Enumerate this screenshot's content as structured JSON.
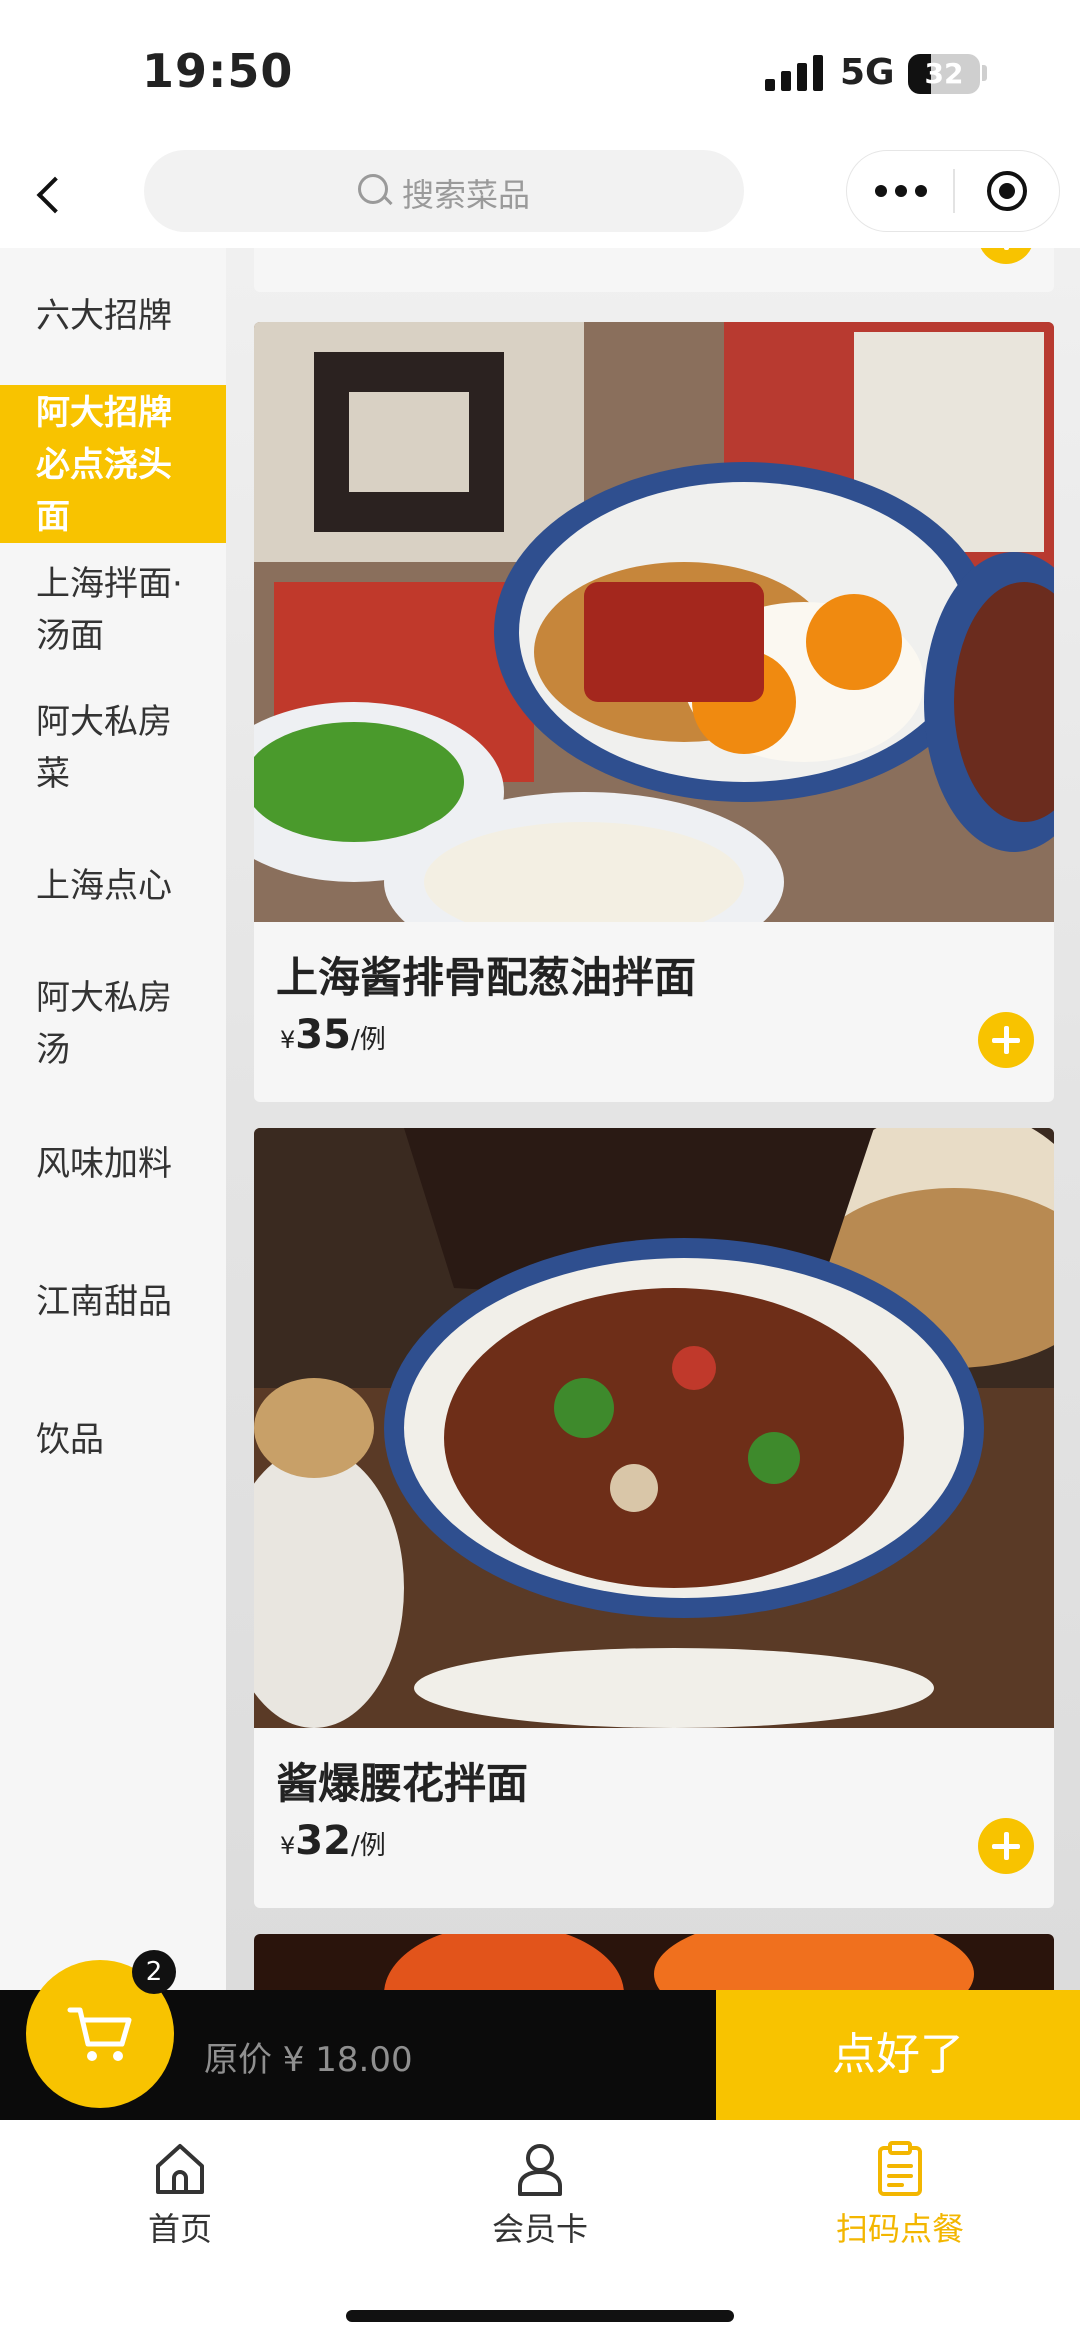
{
  "status": {
    "time": "19:50",
    "network": "5G",
    "battery": "32",
    "battery_level": 0.32
  },
  "header": {
    "search_placeholder": "搜索菜品"
  },
  "sidebar": {
    "items": [
      {
        "label": "六大招牌",
        "active": false
      },
      {
        "label": "阿大招牌必点浇头面",
        "active": true
      },
      {
        "label": "上海拌面·汤面",
        "active": false
      },
      {
        "label": "阿大私房菜",
        "active": false
      },
      {
        "label": "上海点心",
        "active": false
      },
      {
        "label": "阿大私房汤",
        "active": false
      },
      {
        "label": "风味加料",
        "active": false
      },
      {
        "label": "江南甜品",
        "active": false
      },
      {
        "label": "饮品",
        "active": false
      }
    ]
  },
  "products": [
    {
      "name": "上海酱排骨配葱油拌面",
      "currency": "¥",
      "price": "35",
      "unit": "/例"
    },
    {
      "name": "酱爆腰花拌面",
      "currency": "¥",
      "price": "32",
      "unit": "/例"
    }
  ],
  "cart": {
    "count": "2",
    "original_price": "原价 ¥ 18.00",
    "checkout_label": "点好了"
  },
  "tabbar": {
    "items": [
      {
        "label": "首页",
        "icon": "home-icon",
        "active": false
      },
      {
        "label": "会员卡",
        "icon": "member-card-icon",
        "active": false
      },
      {
        "label": "扫码点餐",
        "icon": "scan-order-icon",
        "active": true
      }
    ]
  },
  "colors": {
    "accent": "#f8c300",
    "active_tab": "#f3b600",
    "cart_bar": "#0b0b0b"
  }
}
